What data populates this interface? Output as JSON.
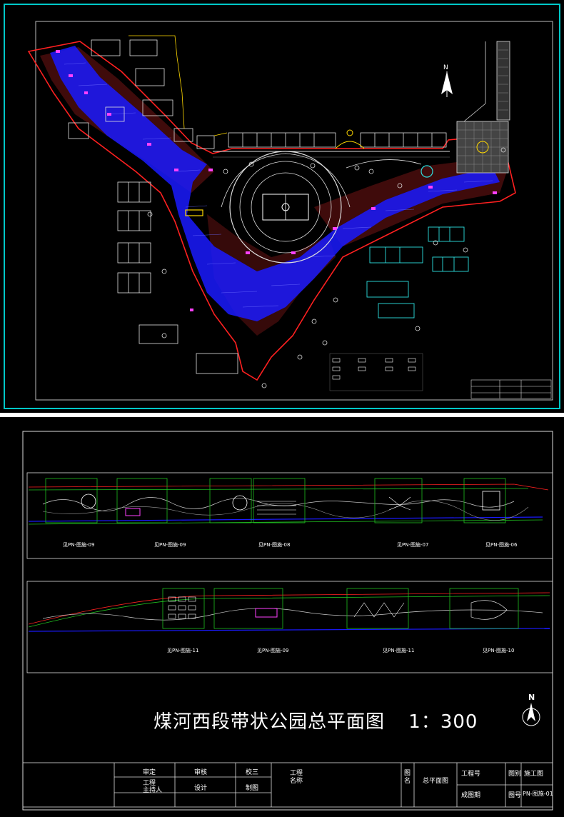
{
  "drawing_title": "煤河西段带状公园总平面图",
  "scale": "1：300",
  "north_label": "N",
  "detail_tags_top": [
    "见PN-图施-09",
    "见PN-图施-09",
    "见PN-图施-08",
    "见PN-图施-07",
    "见PN-图施-06"
  ],
  "detail_tags_bottom": [
    "见PN-图施-11",
    "见PN-图施-09",
    "见PN-图施-11",
    "见PN-图施-10"
  ],
  "title_block": {
    "shen_ding": "审定",
    "shen_he": "审核",
    "jiao_dui": "校三",
    "fuzeren": "工程\n主持人",
    "she_ji": "设计",
    "zhi_tu": "制图",
    "gongcheng_mingcheng": "工程\n名称",
    "tu_ming": "图\n名",
    "drawing_name": "总平面图",
    "gongcheng_hao": "工程号",
    "tu_bie": "图别",
    "tu_bie_value": "施工图",
    "chengtu_riqi": "成图期",
    "tu_hao": "图号",
    "tu_hao_value": "PN-图施-01"
  },
  "colors": {
    "cyan_frame": "#00c8c8",
    "water": "#1a1aff",
    "boundary": "#ff2020",
    "building": "#e0e0e0",
    "accent_magenta": "#ff40ff",
    "accent_yellow": "#ffd800",
    "green": "#20c020"
  }
}
